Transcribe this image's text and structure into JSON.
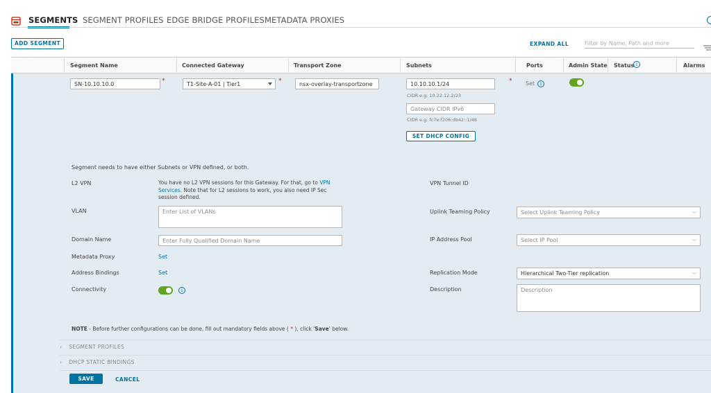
{
  "tabs": [
    {
      "label": "SEGMENTS",
      "active": true
    },
    {
      "label": "SEGMENT PROFILES"
    },
    {
      "label": "EDGE BRIDGE PROFILES"
    },
    {
      "label": "METADATA PROXIES"
    }
  ],
  "toolbar": {
    "add_segment": "ADD SEGMENT",
    "expand_all": "EXPAND ALL",
    "filter_placeholder": "Filter by Name, Path and more"
  },
  "columns": [
    "Segment Name",
    "Connected Gateway",
    "Transport Zone",
    "Subnets",
    "Ports",
    "Admin State",
    "Status",
    "Alarms"
  ],
  "row": {
    "segment_name": "SN-10.10.10.0",
    "gateway": "T1-Site-A-01 | Tier1",
    "transport_zone": "nsx-overlay-transportzone",
    "subnet": "10.10.10.1/24",
    "cidr_hint": "CIDR e.g. 10.22.12.2/23",
    "gateway_ipv6_placeholder": "Gateway CIDR IPv6",
    "cidr_ipv6_hint": "CIDR e.g. fc7e:f206:db42::1/48",
    "set_dhcp_config": "SET DHCP CONFIG",
    "ports_set": "Set"
  },
  "details": {
    "notice": "Segment needs to have either Subnets or VPN defined, or both.",
    "l2vpn_label": "L2 VPN",
    "l2vpn_text_1": "You have no L2 VPN sessions for this Gateway. For that, go to ",
    "l2vpn_link": "VPN",
    "l2vpn_link_2": "Services",
    "l2vpn_text_2": ". Note that for L2 sessions to work, you also need IP Sec",
    "l2vpn_text_3": "session defined.",
    "vpn_tunnel_label": "VPN Tunnel ID",
    "vlan_label": "VLAN",
    "vlan_placeholder": "Enter List of VLANs",
    "uplink_label": "Uplink Teaming Policy",
    "uplink_placeholder": "Select Uplink Teaming Policy",
    "domain_label": "Domain Name",
    "domain_placeholder": "Enter Fully Qualified Domain Name",
    "ip_pool_label": "IP Address Pool",
    "ip_pool_placeholder": "Select IP Pool",
    "metadata_label": "Metadata Proxy",
    "metadata_set": "Set",
    "address_bindings_label": "Address Bindings",
    "address_bindings_set": "Set",
    "replication_label": "Replication Mode",
    "replication_value": "Hierarchical Two-Tier replication",
    "connectivity_label": "Connectivity",
    "description_label": "Description",
    "description_placeholder": "Description",
    "note_bold": "NOTE",
    "note_text_1": " - Before further configurations can be done, fill out mandatory fields above ( ",
    "note_star": "*",
    "note_text_2": " ), click '",
    "note_save": "Save",
    "note_text_3": "' below."
  },
  "sections": {
    "segment_profiles": "SEGMENT PROFILES",
    "dhcp_static_bindings": "DHCP STATIC BINDINGS"
  },
  "actions": {
    "save": "SAVE",
    "cancel": "CANCEL"
  },
  "colors": {
    "accent": "#0072a3",
    "toggle_on": "#62a420",
    "required": "#c92100",
    "expanded_bg": "#e3ecf3"
  }
}
